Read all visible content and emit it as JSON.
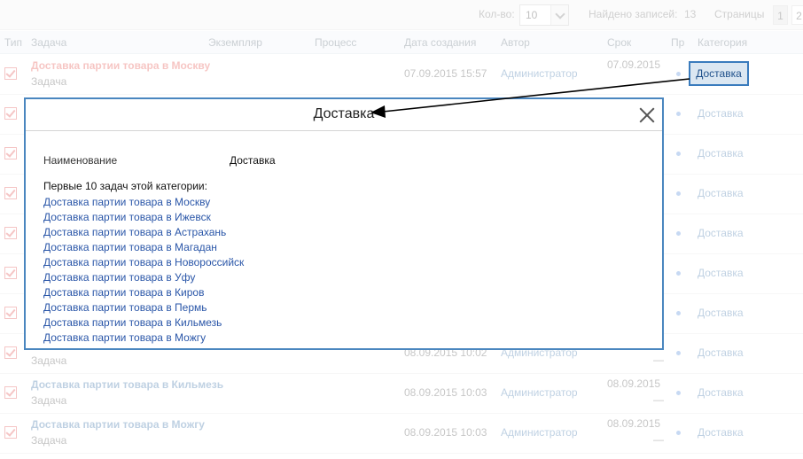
{
  "toolbar": {
    "count_label": "Кол-во:",
    "count_value": "10",
    "found_label": "Найдено записей:",
    "found_value": "13",
    "pages_label": "Страницы",
    "pages": [
      "1",
      "2"
    ]
  },
  "table": {
    "headers": {
      "type": "Тип",
      "task": "Задача",
      "instance": "Экземпляр",
      "process": "Процесс",
      "created": "Дата создания",
      "author": "Автор",
      "term": "Срок",
      "priority": "Пр",
      "category": "Категория"
    },
    "rows": [
      {
        "title": "Доставка партии товара в Москву",
        "sub": "Задача",
        "created": "07.09.2015 15:57",
        "author": "Администратор",
        "term": "07.09.2015",
        "dash": "",
        "category": "Доставка"
      },
      {
        "title": "",
        "sub": "",
        "created": "",
        "author": "",
        "term": "",
        "dash": "",
        "category": "Доставка"
      },
      {
        "title": "",
        "sub": "",
        "created": "",
        "author": "",
        "term": "",
        "dash": "",
        "category": "Доставка"
      },
      {
        "title": "",
        "sub": "",
        "created": "",
        "author": "",
        "term": "",
        "dash": "",
        "category": "Доставка"
      },
      {
        "title": "",
        "sub": "",
        "created": "",
        "author": "",
        "term": "",
        "dash": "",
        "category": "Доставка"
      },
      {
        "title": "",
        "sub": "",
        "created": "",
        "author": "",
        "term": "",
        "dash": "",
        "category": "Доставка"
      },
      {
        "title": "",
        "sub": "",
        "created": "",
        "author": "",
        "term": "",
        "dash": "",
        "category": "Доставка"
      },
      {
        "title": "",
        "sub": "Задача",
        "created": "08.09.2015 10:02",
        "author": "Администратор",
        "term": "",
        "dash": "—",
        "category": "Доставка"
      },
      {
        "title": "Доставка партии товара в Кильмезь",
        "sub": "Задача",
        "created": "08.09.2015 10:03",
        "author": "Администратор",
        "term": "08.09.2015",
        "dash": "—",
        "category": "Доставка"
      },
      {
        "title": "Доставка партии товара в Можгу",
        "sub": "Задача",
        "created": "08.09.2015 10:03",
        "author": "Администратор",
        "term": "08.09.2015",
        "dash": "—",
        "category": "Доставка"
      }
    ]
  },
  "highlight": {
    "category": "Доставка"
  },
  "modal": {
    "title": "Доставка",
    "field_label": "Наименование",
    "field_value": "Доставка",
    "list_heading": "Первые 10 задач этой категории:",
    "tasks": [
      "Доставка партии товара в Москву",
      "Доставка партии товара в Ижевск",
      "Доставка партии товара в Астрахань",
      "Доставка партии товара в Магадан",
      "Доставка партии товара в Новороссийск",
      "Доставка партии товара в Уфу",
      "Доставка партии товара в Киров",
      "Доставка партии товара в Пермь",
      "Доставка партии товара в Кильмезь",
      "Доставка партии товара в Можгу"
    ]
  },
  "colors": {
    "accent": "#4a86bf",
    "link": "#2a56a8",
    "hot": "#e0322b",
    "arrow": "#000000"
  }
}
